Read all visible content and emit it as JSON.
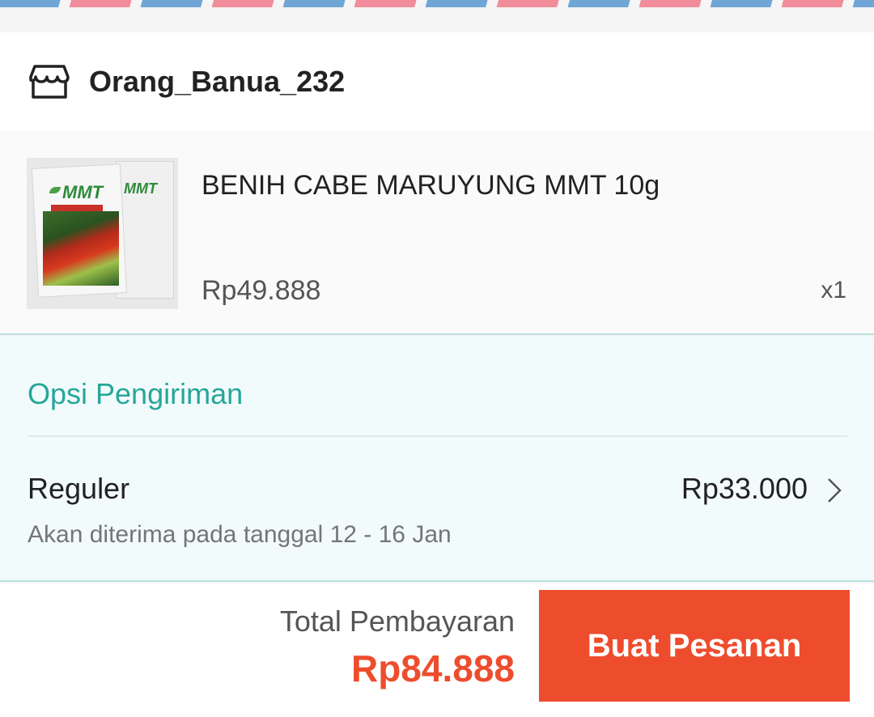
{
  "shop": {
    "name": "Orang_Banua_232",
    "icon": "store-icon"
  },
  "product": {
    "name": "BENIH CABE MARUYUNG MMT 10g",
    "price": "Rp49.888",
    "quantity": "x1",
    "thumbnail_brand": "MMT"
  },
  "shipping": {
    "title": "Opsi Pengiriman",
    "method": "Reguler",
    "cost": "Rp33.000",
    "eta": "Akan diterima pada tanggal 12 - 16 Jan"
  },
  "footer": {
    "total_label": "Total Pembayaran",
    "total_value": "Rp84.888",
    "order_button": "Buat Pesanan"
  },
  "colors": {
    "accent": "#ee4d2d",
    "teal": "#26a69a",
    "stripe_blue": "#6fa6d6",
    "stripe_pink": "#f18d9a"
  }
}
